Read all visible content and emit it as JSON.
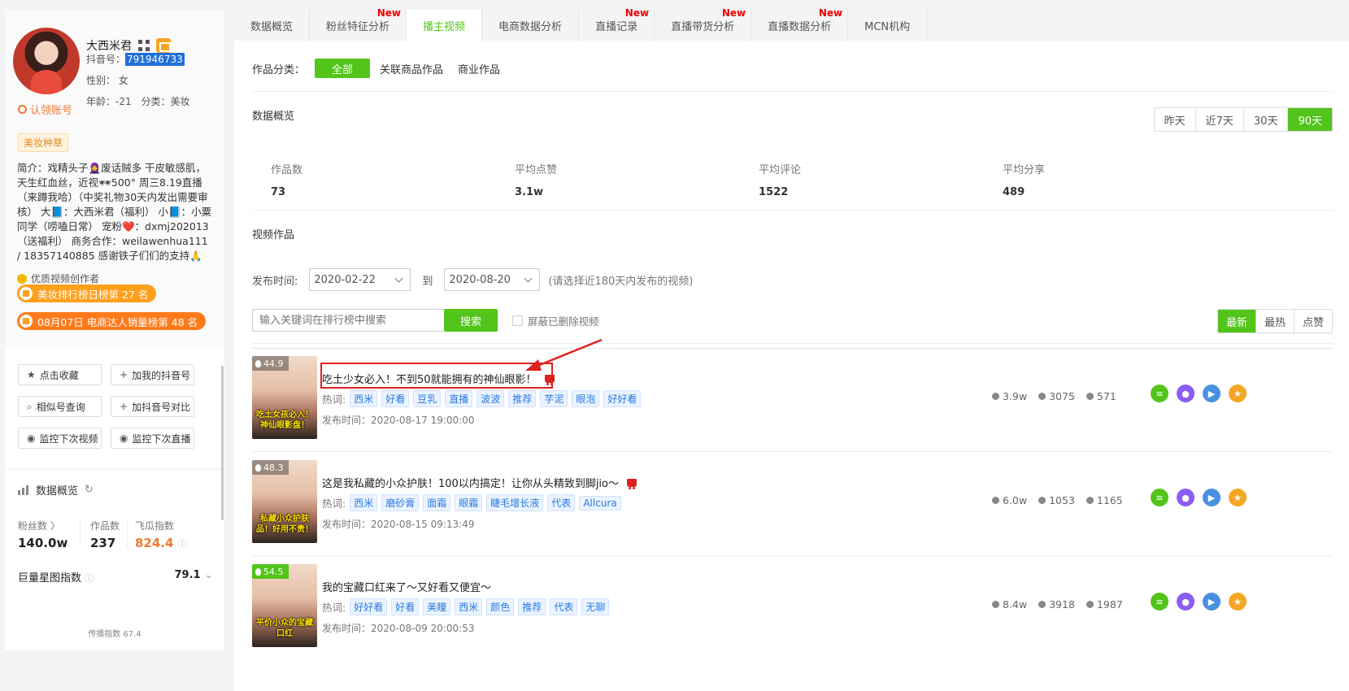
{
  "profile": {
    "nickname": "大西米君",
    "douyin_id_label": "抖音号：",
    "douyin_id": "791946733",
    "gender_label": "性别：",
    "gender": "女",
    "age_label": "年龄：",
    "age": "-21",
    "category_label": "分类：",
    "category": "美妆",
    "claim": "认领账号",
    "tag": "美妆种草",
    "intro": "简介：戏精头子🧕废话贼多 干皮敏感肌，天生红血丝，近视🕶500° 周三8.19直播（来蹲我哈）（中奖礼物30天内发出需要审核） 大📘：大西米君（福利） 小📘：小粟同学（唠嗑日常） 宠粉❤️：dxmj202013（送福利） 商务合作：weilawenhua111 / 18357140885 感谢铁子们们的支持🙏",
    "creator": "优质视频创作者",
    "rank1": "美妆排行榜日榜第 27 名",
    "rank2": "08月07日 电商达人销量榜第 48 名"
  },
  "actions": {
    "collect": "点击收藏",
    "add_mine": "加我的抖音号",
    "similar": "相似号查询",
    "compare": "加抖音号对比",
    "monitor_video": "监控下次视频",
    "monitor_live": "监控下次直播"
  },
  "overview_card": {
    "title": "数据概览",
    "fans_label": "粉丝数 〉",
    "fans": "140.0w",
    "works_label": "作品数",
    "works": "237",
    "feigua_label": "飞瓜指数",
    "feigua": "824.4",
    "star_label": "巨量星图指数",
    "star": "79.1",
    "spread": "传播指数 67.4"
  },
  "tabs": [
    {
      "label": "数据概览",
      "new": ""
    },
    {
      "label": "粉丝特征分析",
      "new": "New"
    },
    {
      "label": "播主视频",
      "new": ""
    },
    {
      "label": "电商数据分析",
      "new": ""
    },
    {
      "label": "直播记录",
      "new": "New"
    },
    {
      "label": "直播带货分析",
      "new": "New"
    },
    {
      "label": "直播数据分析",
      "new": "New"
    },
    {
      "label": "MCN机构",
      "new": ""
    }
  ],
  "category": {
    "label": "作品分类：",
    "all": "全部",
    "related": "关联商品作品",
    "business": "商业作品"
  },
  "overview": {
    "title": "数据概览",
    "ranges": [
      "昨天",
      "近7天",
      "30天",
      "90天"
    ],
    "works_label": "作品数",
    "works": "73",
    "likes_label": "平均点赞",
    "likes": "3.1w",
    "comments_label": "平均评论",
    "comments": "1522",
    "shares_label": "平均分享",
    "shares": "489"
  },
  "videos_section": {
    "title": "视频作品",
    "time_label": "发布时间:",
    "start": "2020-02-22",
    "to": "到",
    "end": "2020-08-20",
    "hint": "(请选择近180天内发布的视频)",
    "search_placeholder": "输入关键词在排行榜中搜索",
    "search_btn": "搜索",
    "hide_deleted": "屏蔽已删除视频",
    "sorts": [
      "最新",
      "最热",
      "点赞"
    ],
    "hot_label": "热词:",
    "time_prefix": "发布时间："
  },
  "videos": [
    {
      "score": "44.9",
      "cover": "吃土女孩必入！神仙眼影盘！",
      "title": "吃土少女必入！不到50就能拥有的神仙眼影！",
      "keywords": [
        "西米",
        "好看",
        "豆乳",
        "直播",
        "波波",
        "推荐",
        "芋泥",
        "眼泡",
        "好好看"
      ],
      "time": "2020-08-17 19:00:00",
      "likes": "3.9w",
      "comments": "3075",
      "shares": "571"
    },
    {
      "score": "48.3",
      "cover": "私藏小众护肤品！好用不贵！",
      "title": "这是我私藏的小众护肤！100以内搞定！让你从头精致到脚jio～",
      "keywords": [
        "西米",
        "磨砂膏",
        "面霜",
        "眼霜",
        "睫毛增长液",
        "代表",
        "Allcura"
      ],
      "time": "2020-08-15 09:13:49",
      "likes": "6.0w",
      "comments": "1053",
      "shares": "1165"
    },
    {
      "score": "54.5",
      "cover": "平价小众的宝藏口红",
      "title": "我的宝藏口红来了～又好看又便宜～",
      "keywords": [
        "好好看",
        "好看",
        "美瞳",
        "西米",
        "颜色",
        "推荐",
        "代表",
        "无聊"
      ],
      "time": "2020-08-09 20:00:53",
      "likes": "8.4w",
      "comments": "3918",
      "shares": "1987"
    }
  ],
  "colors": {
    "accent": "#52c41a",
    "warn": "#f07832",
    "new": "#e00000"
  }
}
